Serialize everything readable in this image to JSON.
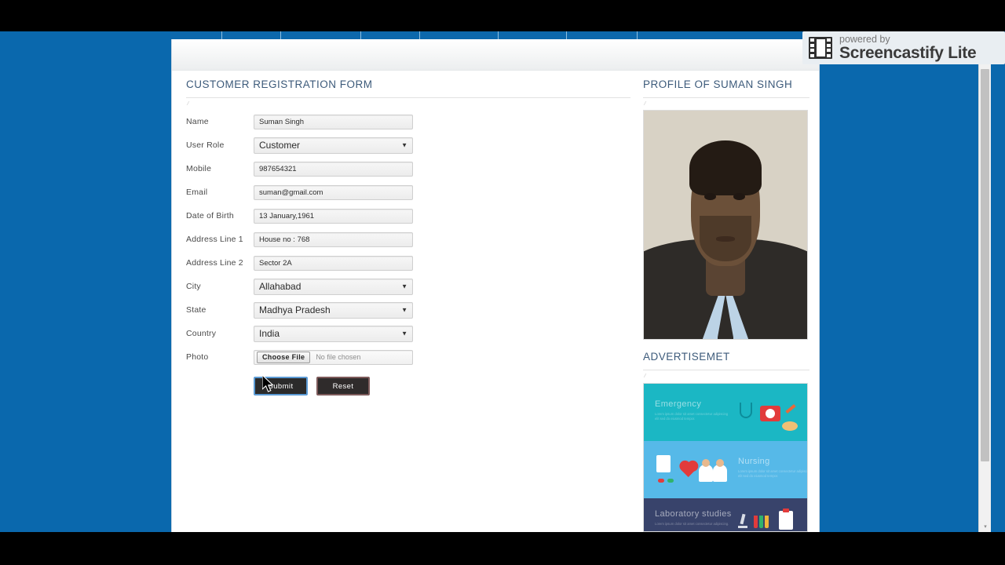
{
  "window": {
    "background_color": "#0a68ad",
    "letterbox_color": "#000000"
  },
  "watermark": {
    "line1": "powered by",
    "line2": "Screencastify Lite",
    "icon": "film-strip-icon"
  },
  "topnav": {
    "item_count": 8,
    "note": "navigation bar clipped at top of viewport"
  },
  "form": {
    "title": "CUSTOMER REGISTRATION FORM",
    "fields": [
      {
        "label": "Name",
        "type": "text",
        "value": "Suman Singh",
        "name": "name-field"
      },
      {
        "label": "User Role",
        "type": "select",
        "value": "Customer",
        "name": "user-role-select"
      },
      {
        "label": "Mobile",
        "type": "text",
        "value": "987654321",
        "name": "mobile-field"
      },
      {
        "label": "Email",
        "type": "text",
        "value": "suman@gmail.com",
        "name": "email-field"
      },
      {
        "label": "Date of Birth",
        "type": "text",
        "value": "13 January,1961",
        "name": "dob-field"
      },
      {
        "label": "Address Line 1",
        "type": "text",
        "value": "House no : 768",
        "name": "address-line-1-field"
      },
      {
        "label": "Address Line 2",
        "type": "text",
        "value": "Sector 2A",
        "name": "address-line-2-field"
      },
      {
        "label": "City",
        "type": "select",
        "value": "Allahabad",
        "name": "city-select"
      },
      {
        "label": "State",
        "type": "select",
        "value": "Madhya Pradesh",
        "name": "state-select"
      },
      {
        "label": "Country",
        "type": "select",
        "value": "India",
        "name": "country-select"
      },
      {
        "label": "Photo",
        "type": "file",
        "value": "",
        "name": "photo-file-input"
      }
    ],
    "file": {
      "button_label": "Choose File",
      "status_text": "No file chosen"
    },
    "buttons": {
      "submit": "Submit",
      "reset": "Reset",
      "submit_focus_color": "#5b9bd5",
      "reset_border_color": "#7d5a5a"
    }
  },
  "profile": {
    "title": "PROFILE OF SUMAN SINGH",
    "photo_alt": "portrait photograph of a man in a dark suit and light blue shirt"
  },
  "advertisement": {
    "title": "ADVERTISEMET",
    "panels": [
      {
        "heading": "Emergency",
        "body": "Lorem ipsum dolor sit amet consectetur adipiscing elit sed do eiusmod tempor.",
        "color": "#1bb7c4"
      },
      {
        "heading": "Nursing",
        "body": "Lorem ipsum dolor sit amet consectetur adipiscing elit sed do eiusmod tempor.",
        "color": "#56b9e8"
      },
      {
        "heading": "Laboratory studies",
        "body": "Lorem ipsum dolor sit amet consectetur adipiscing.",
        "color": "#38436b"
      }
    ]
  },
  "scrollbar": {
    "up_arrow": "▴",
    "down_arrow": "▾"
  },
  "colors": {
    "accent_blue": "#0a68ad",
    "heading_blue": "#3c5a7a"
  }
}
